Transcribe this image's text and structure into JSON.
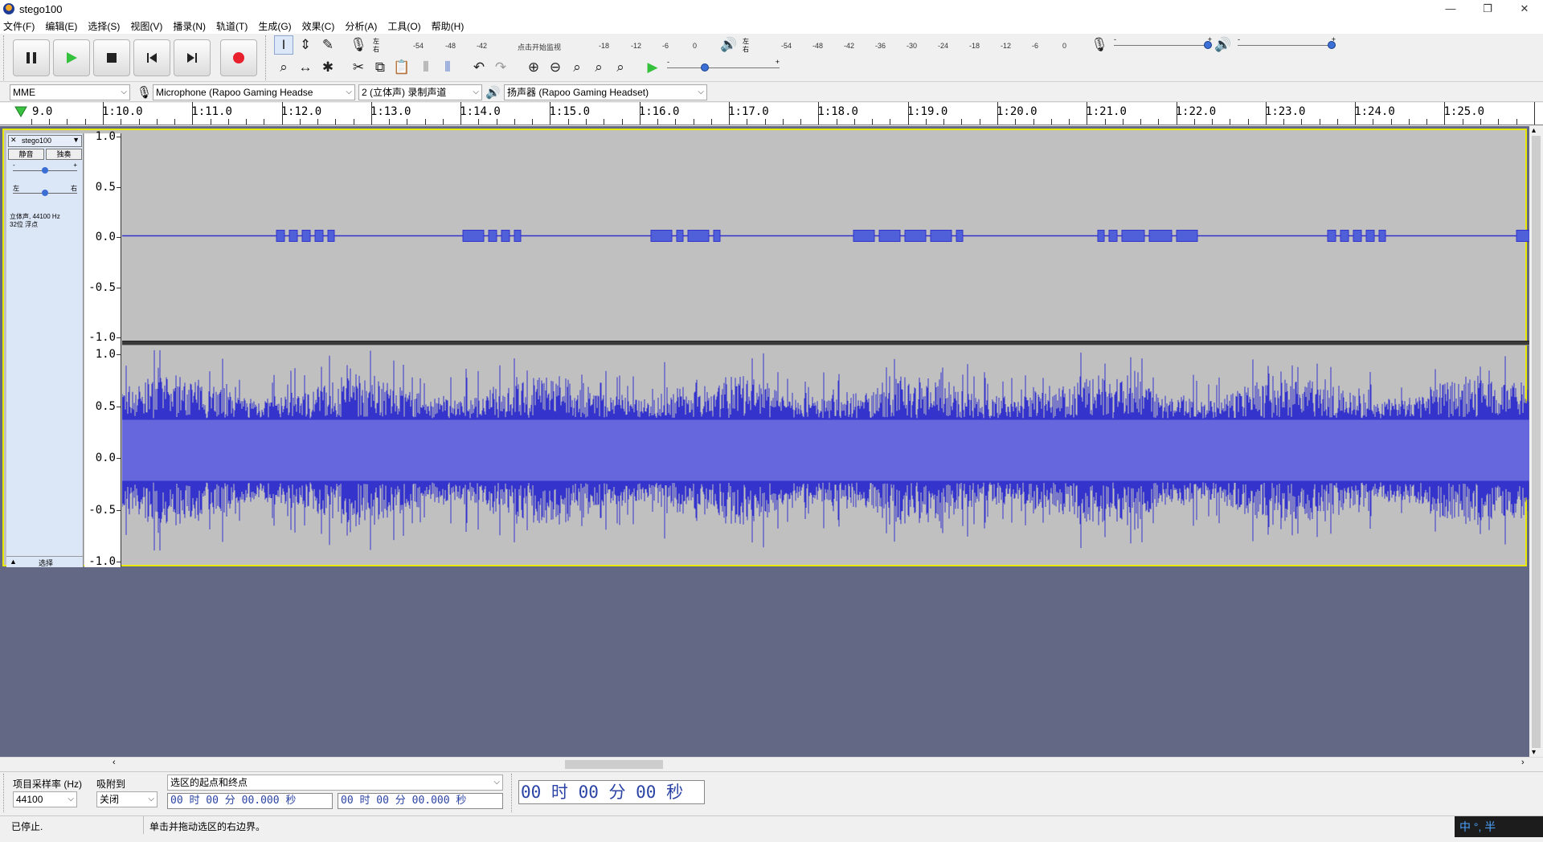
{
  "window": {
    "title": "stego100",
    "minimize": "—",
    "restore": "❐",
    "close": "✕"
  },
  "menu": [
    "文件(F)",
    "编辑(E)",
    "选择(S)",
    "视图(V)",
    "播录(N)",
    "轨道(T)",
    "生成(G)",
    "效果(C)",
    "分析(A)",
    "工具(O)",
    "帮助(H)"
  ],
  "transport": {
    "pause": "pause-icon",
    "play": "play-icon",
    "stop": "stop-icon",
    "skip_start": "skip-start-icon",
    "skip_end": "skip-end-icon",
    "record": "record-icon"
  },
  "meters": {
    "record_scale": [
      "-54",
      "-48",
      "-42",
      "点击开始监视",
      "-18",
      "-12",
      "-6",
      "0"
    ],
    "playback_scale": [
      "-54",
      "-48",
      "-42",
      "-36",
      "-30",
      "-24",
      "-18",
      "-12",
      "-6",
      "0"
    ],
    "lr_left": "左",
    "lr_right": "右",
    "mixer_minus": "-",
    "mixer_plus": "+",
    "record_volume": 1.0,
    "playback_volume": 1.0,
    "play_speed": 0.35
  },
  "devices": {
    "host": "MME",
    "input": "Microphone (Rapoo Gaming Headse",
    "channels": "2 (立体声) 录制声道",
    "output": "扬声器 (Rapoo Gaming Headset)"
  },
  "ruler": {
    "labels": [
      "9.0",
      "1:10.0",
      "1:11.0",
      "1:12.0",
      "1:13.0",
      "1:14.0",
      "1:15.0",
      "1:16.0",
      "1:17.0",
      "1:18.0",
      "1:19.0",
      "1:20.0",
      "1:21.0",
      "1:22.0",
      "1:23.0",
      "1:24.0",
      "1:25.0"
    ]
  },
  "track": {
    "name": "stego100",
    "mute": "静音",
    "solo": "独奏",
    "gain_minus": "-",
    "gain_plus": "+",
    "pan_left": "左",
    "pan_right": "右",
    "info_line1": "立体声, 44100 Hz",
    "info_line2": "32位 浮点",
    "collapse": "▲",
    "select": "选择",
    "scale_top": [
      "1.0",
      "0.5",
      "0.0",
      "-0.5",
      "-1.0"
    ],
    "scale_bottom": [
      "1.0",
      "0.5",
      "0.0",
      "-0.5",
      "-1.0"
    ]
  },
  "selection_toolbar": {
    "rate_label": "项目采样率 (Hz)",
    "rate_value": "44100",
    "snap_label": "吸附到",
    "snap_value": "关闭",
    "mode_value": "选区的起点和终点",
    "start_time": "00 时 00 分 00.000 秒",
    "end_time": "00 时 00 分 00.000 秒",
    "big_time": "00 时 00 分 00 秒"
  },
  "status": {
    "state": "已停止.",
    "hint": "单击并拖动选区的右边界。",
    "ime": "中 °, 半"
  }
}
